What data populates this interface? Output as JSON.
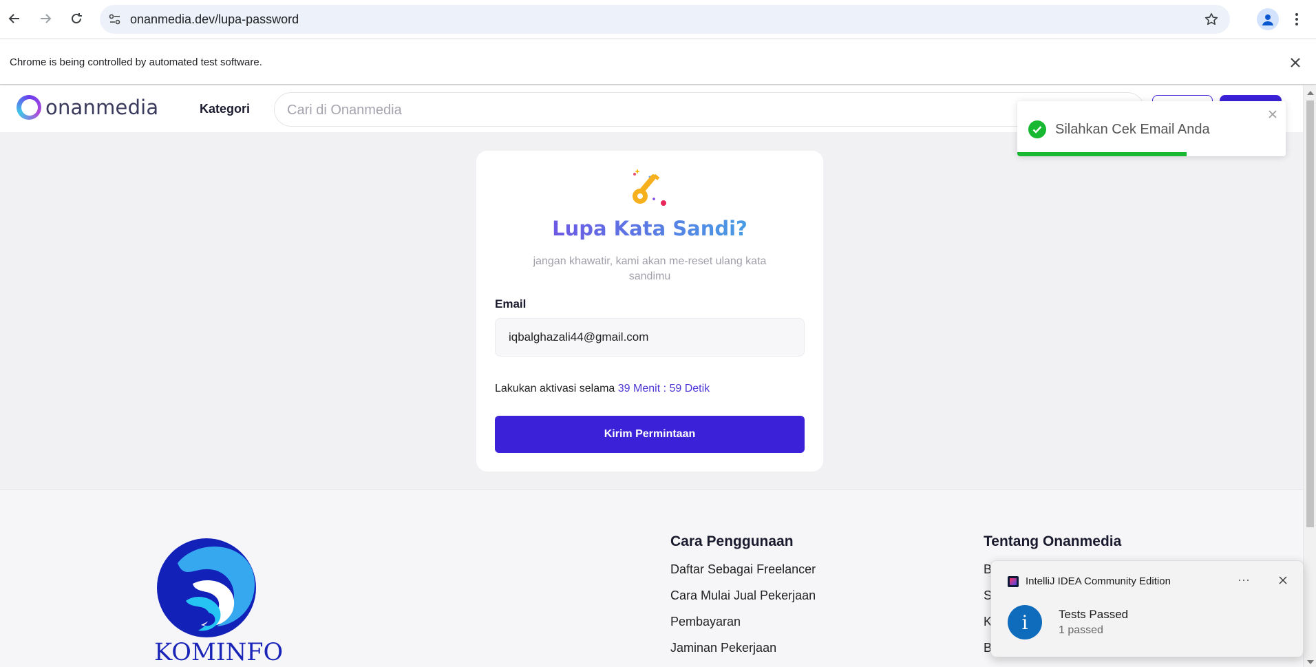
{
  "browser": {
    "url": "onanmedia.dev/lupa-password",
    "infobar_text": "Chrome is being controlled by automated test software."
  },
  "site": {
    "logo_text": "onanmedia",
    "nav_kategori": "Kategori",
    "search_placeholder": "Cari di Onanmedia"
  },
  "card": {
    "title": "Lupa Kata Sandi?",
    "subtitle": "jangan khawatir, kami akan me-reset ulang kata sandimu",
    "email_label": "Email",
    "email_value": "iqbalghazali44@gmail.com",
    "activation_prefix": "Lakukan aktivasi selama",
    "activation_timer": "39 Menit : 59 Detik",
    "submit_label": "Kirim Permintaan"
  },
  "footer": {
    "kominfo_text": "KOMINFO",
    "col1_title": "Cara Penggunaan",
    "col1_links": [
      "Daftar Sebagai Freelancer",
      "Cara Mulai Jual Pekerjaan",
      "Pembayaran",
      "Jaminan Pekerjaan"
    ],
    "col2_title": "Tentang Onanmedia",
    "col2_links": [
      "B",
      "S",
      "K",
      "Blog"
    ]
  },
  "toast": {
    "message": "Silahkan Cek Email Anda",
    "progress_fraction": 0.63,
    "color": "#18b832"
  },
  "notification": {
    "app_name": "IntelliJ IDEA Community Edition",
    "more": "···",
    "title": "Tests Passed",
    "body": "1 passed",
    "icon_glyph": "i"
  },
  "colors": {
    "primary": "#3b22d8",
    "timer": "#4b36d6",
    "title_gradient_start": "#7b3fe4",
    "title_gradient_end": "#3ab6e3"
  }
}
